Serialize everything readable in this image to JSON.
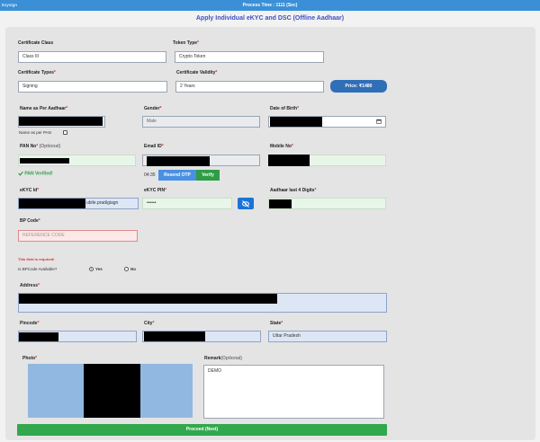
{
  "header": {
    "logo_text": "Ezysign",
    "process_time": "Process Time : 1111 (Sec)",
    "page_title": "Apply Individual eKYC and DSC (Offline Aadhaar)"
  },
  "certificate": {
    "class_label": "Certificate Class",
    "class_value": "Class III",
    "token_type_label": "Token Type",
    "token_type_value": "Crypto Token",
    "types_label": "Certificate Types",
    "types_value": "Signing",
    "validity_label": "Certificate Validity",
    "validity_value": "2 Years",
    "price_button": "Price: ₹1480"
  },
  "personal": {
    "name_label": "Name as Per Aadhaar",
    "name_as_pan_label": "Name as per PAN",
    "gender_label": "Gender",
    "gender_value": "Male",
    "dob_label": "Date of Birth",
    "pan_label": "PAN No",
    "pan_optional": "(Optional)",
    "pan_verified": "PAN Verified!",
    "email_label": "Email ID",
    "otp_timer": "04:35",
    "resend_otp": "Resend OTP",
    "verify": "Verify",
    "mobile_label": "Mobile No",
    "ekyc_id_label": "eKYC Id",
    "ekyc_id_value": "ubile.pradigiagn",
    "ekyc_pin_label": "eKYC PIN",
    "ekyc_pin_value": "••••••",
    "aadhaar_label": "Aadhaar last 4 Digits",
    "bp_code_label": "BP Code",
    "bp_code_placeholder": "REFERENCE CODE",
    "bp_error": "This field is required!",
    "bp_available_label": "Is BPCode Available?",
    "yes_label": "Yes",
    "no_label": "No"
  },
  "address": {
    "address_label": "Address",
    "pincode_label": "Pincode",
    "city_label": "City",
    "state_label": "State",
    "state_value": "Uttar Pradesh"
  },
  "bottom": {
    "photo_label": "Photo",
    "remark_label": "Remark",
    "remark_optional": "(Optional)",
    "remark_value": "DEMO",
    "proceed_button": "Proceed (Next)"
  },
  "colors": {
    "topbar": "#3a8fd6",
    "title": "#3f51c2",
    "verify_green": "#2e9d45",
    "price_blue": "#2f6fb8",
    "error_red": "#d32f2f"
  },
  "icons": {
    "verified": "check-icon",
    "eye": "eye-slash-icon",
    "calendar": "calendar-icon"
  }
}
